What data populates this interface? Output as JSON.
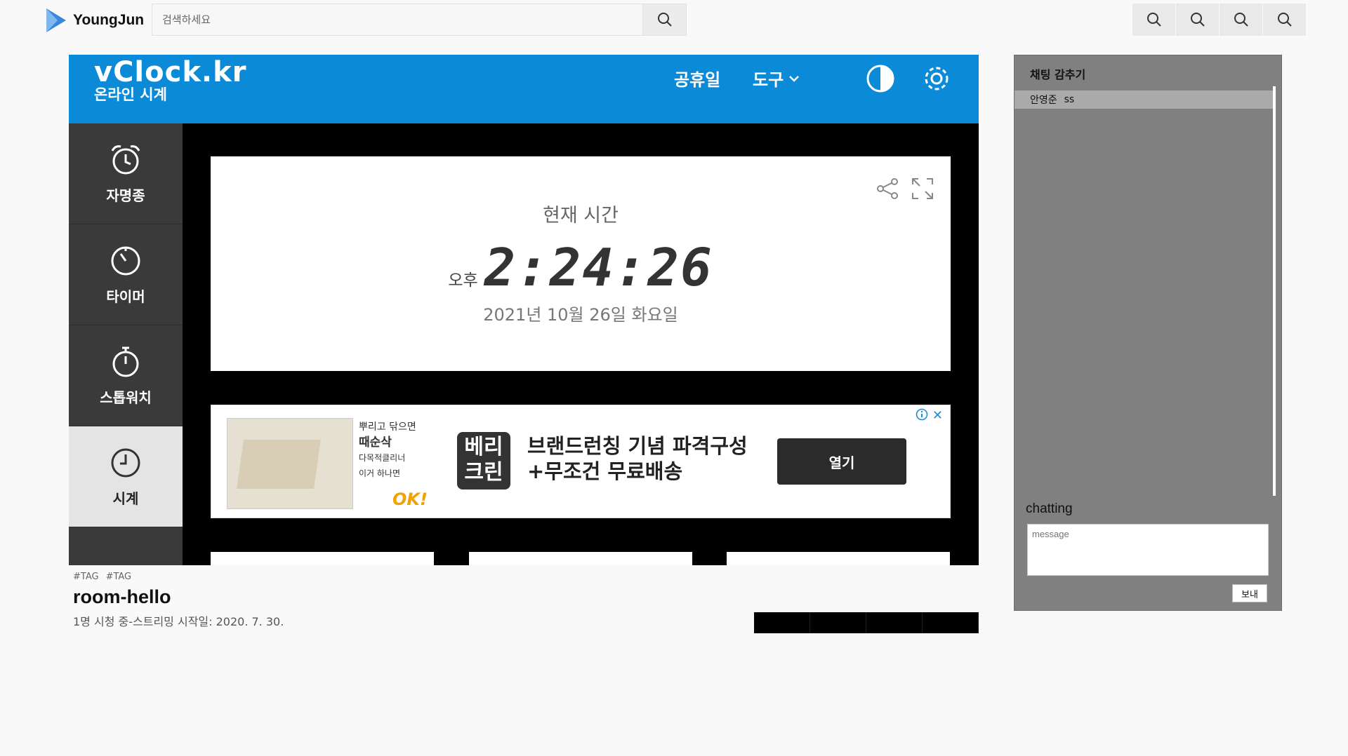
{
  "header": {
    "brand": "YoungJun",
    "search_placeholder": "검색하세요",
    "zoom_icons": [
      "search-icon",
      "search-icon",
      "search-icon",
      "search-icon"
    ]
  },
  "vclock": {
    "brand_name": "vClock.kr",
    "brand_sub": "온라인 시계",
    "nav_holiday": "공휴일",
    "nav_tools": "도구",
    "sidebar": [
      {
        "label": "자명종",
        "icon": "alarm-icon"
      },
      {
        "label": "타이머",
        "icon": "timer-icon"
      },
      {
        "label": "스톱워치",
        "icon": "stopwatch-icon"
      },
      {
        "label": "시계",
        "icon": "clock-icon",
        "active": true
      }
    ],
    "clock": {
      "label": "현재 시간",
      "ampm": "오후",
      "time": "2:24:26",
      "date": "2021년 10월 26일 화요일"
    },
    "ad": {
      "side_line1": "뿌리고 닦으면",
      "side_line2": "때순삭",
      "side_line3": "다목적클리너",
      "side_line4": "이거 하나면",
      "side_ok": "OK!",
      "logo": "베리\n크린",
      "headline_1": "브랜드런칭 기념 파격구성",
      "headline_2": "+무조건 무료배송",
      "button": "열기",
      "close": "✕"
    }
  },
  "room": {
    "tags": [
      "#TAG",
      "#TAG"
    ],
    "title": "room-hello",
    "meta": "1명 시청 중-스트리밍 시작일: 2020. 7. 30."
  },
  "chat": {
    "hide_label": "채팅 감추기",
    "messages": [
      {
        "user": "안영준",
        "text": "ss"
      }
    ],
    "input_label": "chatting",
    "input_placeholder": "message",
    "send_label": "보내"
  },
  "colors": {
    "accent": "#0b8ad8",
    "chat_bg": "#808080"
  }
}
